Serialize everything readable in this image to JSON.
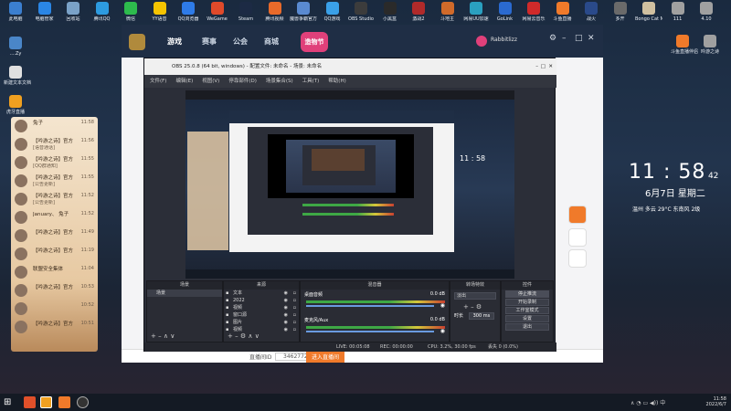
{
  "desktop": {
    "top_icons": [
      {
        "label": "此电脑",
        "color": "#3b7fd0"
      },
      {
        "label": "电脑管家",
        "color": "#2a86e6"
      },
      {
        "label": "回收站",
        "color": "#7aa2c8"
      },
      {
        "label": "腾讯QQ",
        "color": "#2d9be0"
      },
      {
        "label": "微信",
        "color": "#2dbb4d"
      },
      {
        "label": "YY语音",
        "color": "#f5c400"
      },
      {
        "label": "QQ浏览器",
        "color": "#2e7be8"
      },
      {
        "label": "WeGame",
        "color": "#e04a2a"
      },
      {
        "label": "Steam",
        "color": "#1c2a44"
      },
      {
        "label": "腾讯视频",
        "color": "#e86a2a"
      },
      {
        "label": "魔兽争霸官方",
        "color": "#5a8ad0"
      },
      {
        "label": "QQ游戏",
        "color": "#3aa0e8"
      },
      {
        "label": "OBS Studio",
        "color": "#3c3c3c"
      },
      {
        "label": "小黑盒",
        "color": "#2a2a2a"
      },
      {
        "label": "激战2",
        "color": "#b02a2a"
      },
      {
        "label": "斗地主",
        "color": "#d06a2a"
      },
      {
        "label": "网易UU加速",
        "color": "#2aa0c0"
      },
      {
        "label": "GoLink",
        "color": "#2a6ad0"
      },
      {
        "label": "网易云音乐",
        "color": "#d02a2a"
      },
      {
        "label": "斗鱼直播",
        "color": "#f07a2a"
      },
      {
        "label": "战火",
        "color": "#2a4a8a"
      },
      {
        "label": "多开",
        "color": "#6a6a6a"
      },
      {
        "label": "Bongo Cat Mver",
        "color": "#d0c0a0"
      },
      {
        "label": "111",
        "color": "#a0a0a0"
      },
      {
        "label": "4.10",
        "color": "#a0a0a0"
      }
    ],
    "left_icons": [
      {
        "label": "....Zy",
        "color": "#4a86c8"
      },
      {
        "label": "新建文本文档",
        "color": "#e0e0e0"
      },
      {
        "label": "虎牙直播",
        "color": "#f0a020"
      }
    ],
    "right_icons": [
      {
        "label": "斗鱼直播伴侣",
        "color": "#f07a2a"
      },
      {
        "label": "吟游之诗",
        "color": "#a0a0a0"
      }
    ],
    "clock": {
      "time": "11 : 58",
      "seconds": "42",
      "date": "6月7日 星期二",
      "weather": "温州 多云 29°C 东南风 2级"
    }
  },
  "qq_panel": {
    "items": [
      {
        "name": "兔子",
        "preview": "",
        "time": "11:58"
      },
      {
        "name": "【吟游之诗】官方",
        "preview": "[语音通话]",
        "time": "11:56"
      },
      {
        "name": "【吟游之诗】官方",
        "preview": "[QQ群通知]",
        "time": "11:55"
      },
      {
        "name": "【吟游之诗】官方",
        "preview": "[公告更新]",
        "time": "11:55"
      },
      {
        "name": "【吟游之诗】官方",
        "preview": "[公告更新]",
        "time": "11:52"
      },
      {
        "name": "January、 兔子",
        "preview": "",
        "time": "11:52"
      },
      {
        "name": "【吟游之诗】官方",
        "preview": "",
        "time": "11:49"
      },
      {
        "name": "【吟游之诗】官方",
        "preview": "",
        "time": "11:19"
      },
      {
        "name": "联盟安全集体",
        "preview": "",
        "time": "11:04"
      },
      {
        "name": "【吟游之诗】官方",
        "preview": "",
        "time": "10:53"
      },
      {
        "name": "",
        "preview": "",
        "time": "10:52"
      },
      {
        "name": "【吟游之诗】官方",
        "preview": "",
        "time": "10:51"
      }
    ]
  },
  "client": {
    "nav": [
      "游戏",
      "赛事",
      "公会",
      "商城"
    ],
    "badge": "造物节",
    "username": "Rabbitlizz",
    "controls": [
      "settings-icon",
      "minimize-icon",
      "maximize-icon",
      "close-icon"
    ]
  },
  "obs": {
    "title": "OBS 25.0.8 (64 bit, windows) - 配置文件: 未命名 - 场景: 未命名",
    "menu": [
      "文件(F)",
      "编辑(E)",
      "视图(V)",
      "停靠部件(D)",
      "场景集合(S)",
      "工具(T)",
      "帮助(H)"
    ],
    "panels": {
      "scenes_header": "场景",
      "scenes": [
        "场景"
      ],
      "sources_header": "来源",
      "sources": [
        "文本",
        "2022",
        "视频",
        "窗口源",
        "图片",
        "视频"
      ],
      "mixer_header": "混音器",
      "mixer_tracks": [
        {
          "name": "桌面音频",
          "value": "0.0 dB"
        },
        {
          "name": "麦克风/Aux",
          "value": "0.0 dB"
        }
      ],
      "transitions_header": "转场特效",
      "transition": "淡出",
      "duration_label": "时长",
      "duration_value": "300 ms",
      "controls_header": "控件",
      "controls": [
        "停止推流",
        "开始录制",
        "工作室模式",
        "设置",
        "退出"
      ]
    },
    "status": {
      "live": "LIVE: 00:05:08",
      "rec": "REC: 00:00:00",
      "cpu": "CPU: 3.2%, 30.00 fps",
      "dropped": "丢失 0 (0.0%)"
    }
  },
  "bottom_bar": {
    "label": "直播间ID",
    "room": "3462772",
    "button": "进入直播间"
  },
  "taskbar": {
    "time": "11:58",
    "date": "2022/6/7"
  }
}
